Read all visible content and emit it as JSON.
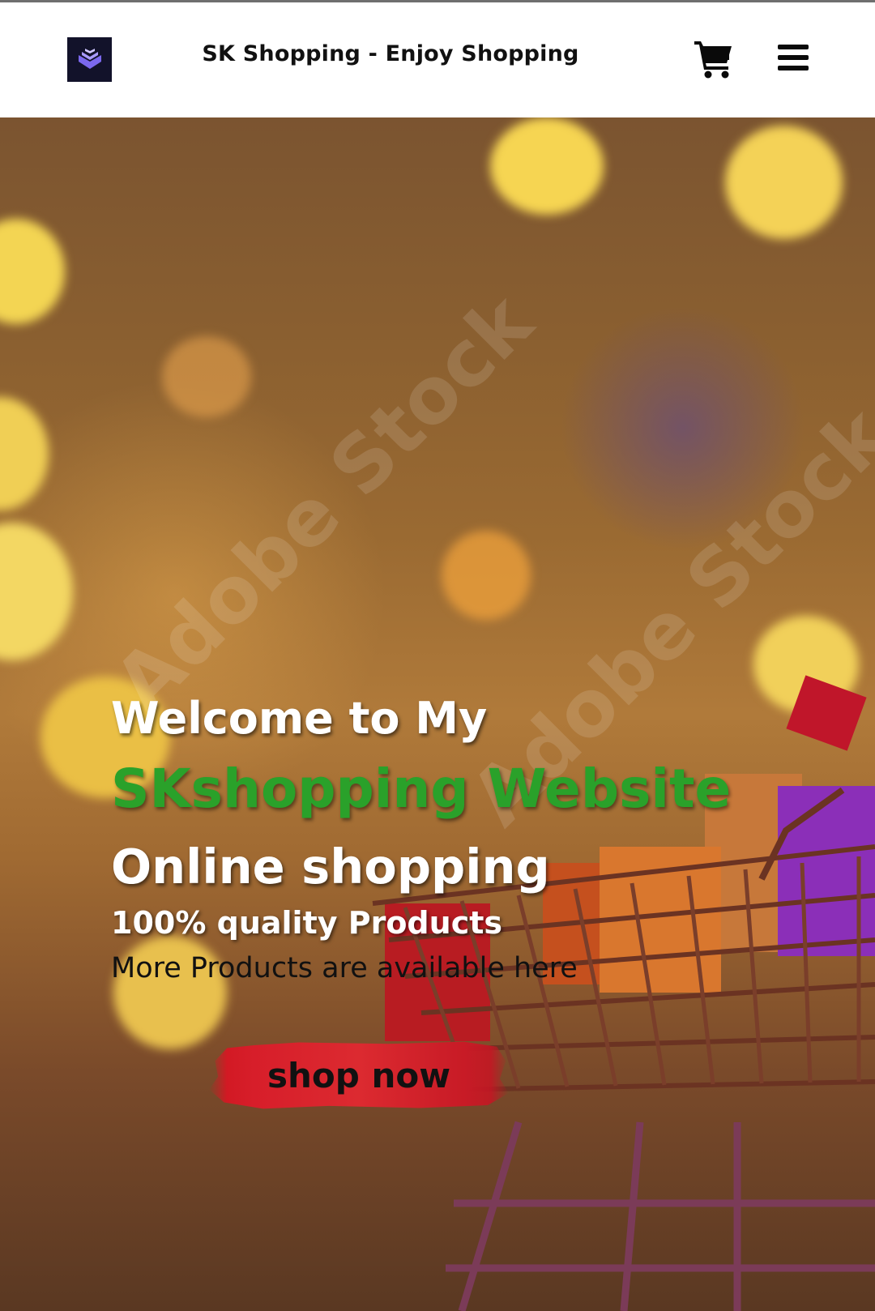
{
  "header": {
    "site_title": "SK Shopping - Enjoy Shopping",
    "logo_icon": "stacked-layers-logo-icon",
    "cart_icon": "shopping-cart-icon",
    "menu_icon": "hamburger-menu-icon"
  },
  "hero": {
    "welcome_line": "Welcome to My",
    "brand_line": "SKshopping Website",
    "tagline": "Online shopping",
    "quality_line": "100% quality Products",
    "more_line": "More Products are available here",
    "cta_label": "shop now",
    "watermark_text": "Adobe Stock",
    "colors": {
      "brand_green": "#2aa12a",
      "cta_red": "#d71e2a",
      "logo_bg": "#12122a",
      "logo_accent": "#7b68ee"
    }
  }
}
